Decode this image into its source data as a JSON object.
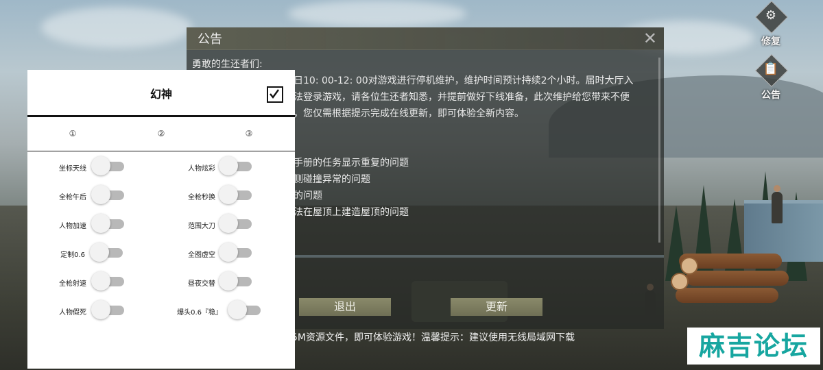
{
  "notice": {
    "title": "公告",
    "close_symbol": "✕",
    "greeting": "勇敢的生还者们:",
    "paragraph_lines": [
      "日10: 00-12: 00对游戏进行停机维护，维护时间预计持续2个小时。届时大厅入",
      "法登录游戏，请各位生还者知悉，并提前做好下线准备，此次维护给您带来不便",
      "，您仅需根据提示完成在线更新，即可体验全新内容。"
    ],
    "fix_lines": [
      "手册的任务显示重复的问题",
      "侧碰撞异常的问题",
      "的问题",
      "法在屋顶上建造屋顶的问题"
    ],
    "buttons": {
      "exit": "退出",
      "update": "更新"
    },
    "download_tip": "5M资源文件，即可体验游戏！温馨提示：建议使用无线局域网下载"
  },
  "side_buttons": [
    {
      "label": "修复",
      "icon": "gears-icon"
    },
    {
      "label": "公告",
      "icon": "notice-icon"
    }
  ],
  "panel": {
    "title": "幻神",
    "checkbox_checked": true,
    "tabs": [
      "①",
      "②",
      "③"
    ],
    "left_options": [
      "坐标天线",
      "全枪午后",
      "人物加速",
      "定制0.6",
      "全枪射速",
      "人物假死"
    ],
    "right_options": [
      "人物炫彩",
      "全枪秒换",
      "范围大刀",
      "全图虚空",
      "昼夜交替",
      "爆头0.6『稳』"
    ]
  },
  "watermark": "麻吉论坛",
  "colors": {
    "watermark_text": "#17a6a0",
    "toggle_track": "#b8b8b8",
    "button_fill": "#7c7c60"
  }
}
